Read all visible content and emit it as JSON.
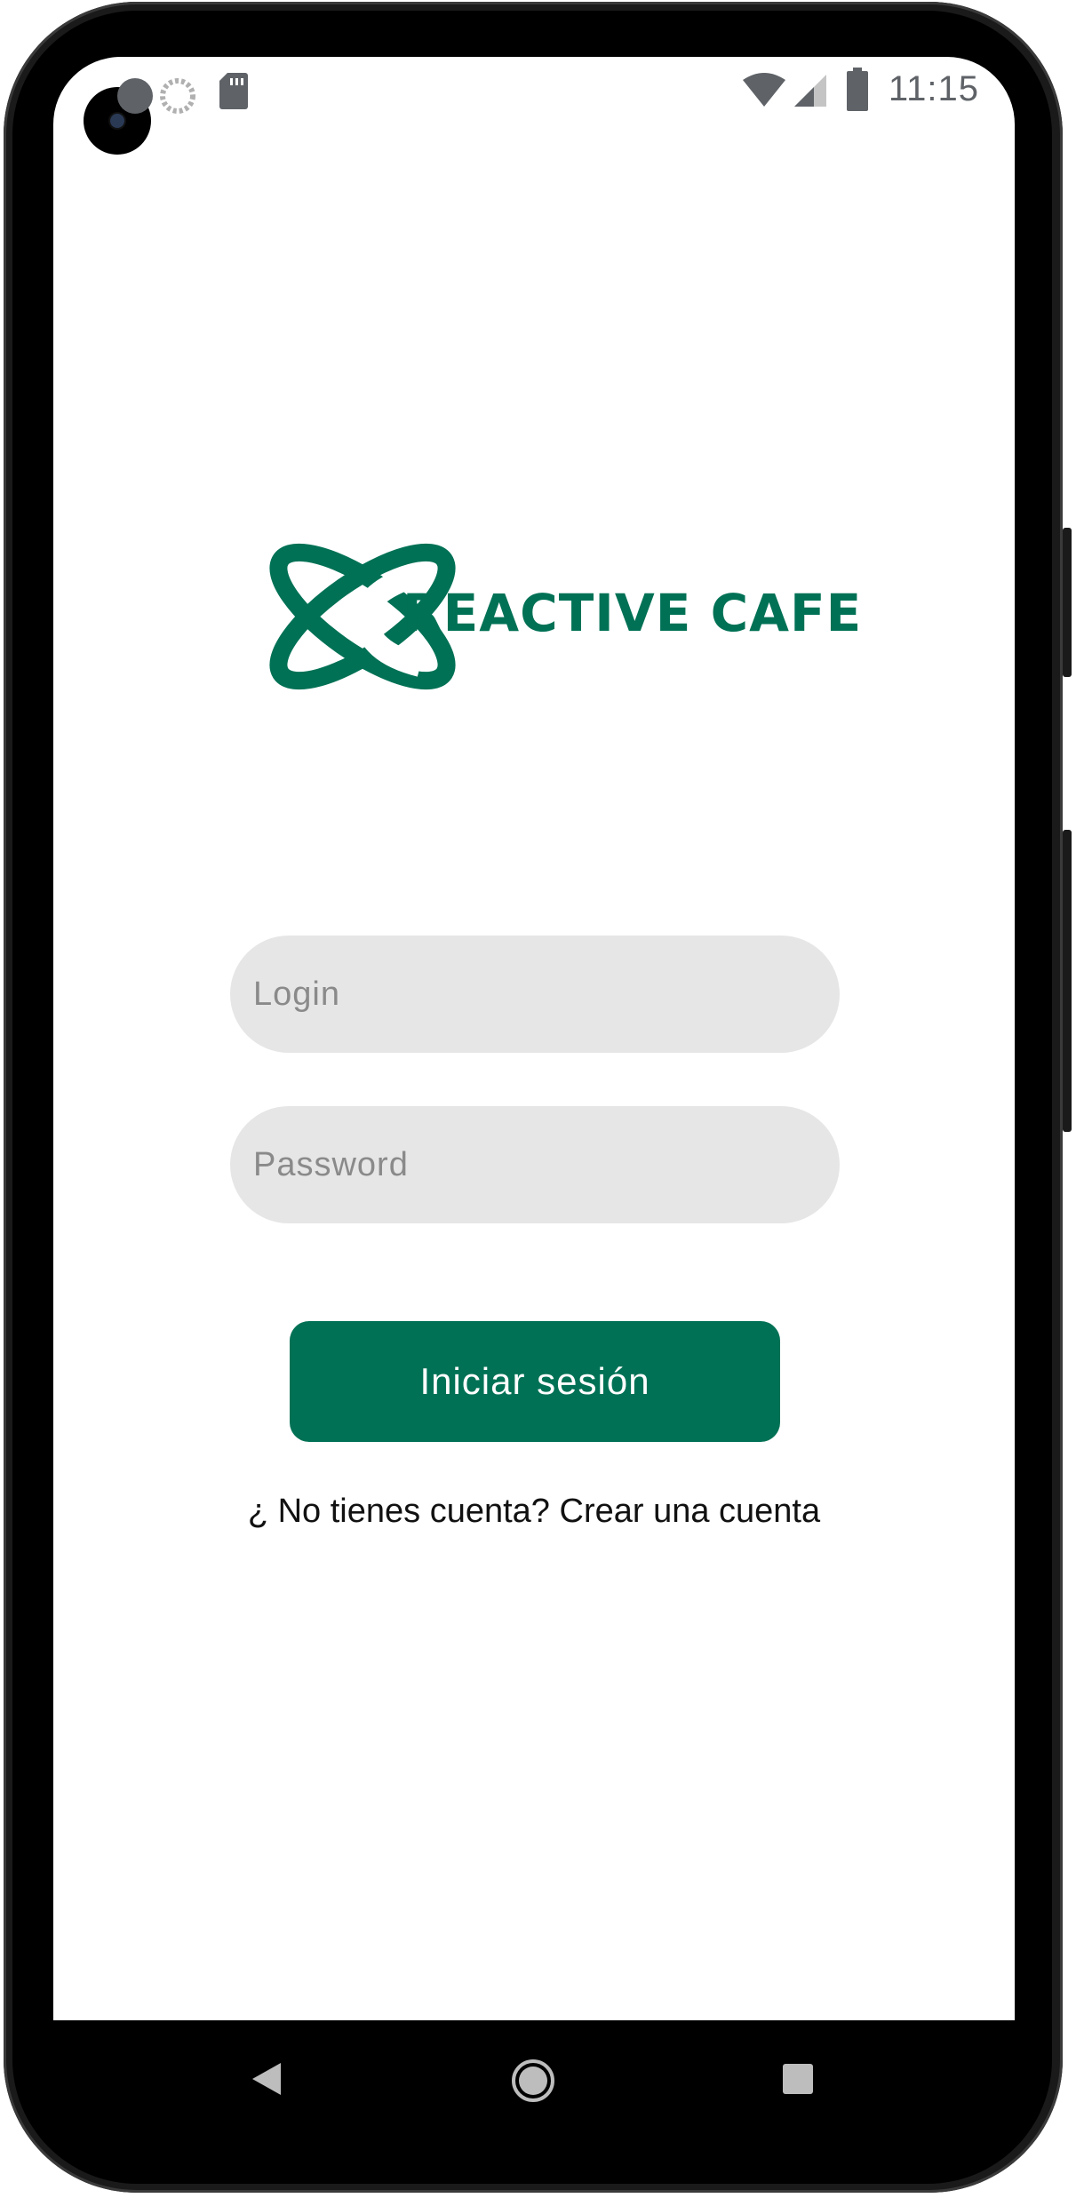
{
  "status_bar": {
    "time": "11:15",
    "left_icons": [
      "a-icon",
      "loading-circle-icon",
      "sd-card-icon"
    ],
    "right_icons": [
      "wifi-icon",
      "signal-icon",
      "battery-icon"
    ]
  },
  "logo": {
    "text": "REACTIVE CAFE",
    "color": "#007155"
  },
  "form": {
    "login_placeholder": "Login",
    "login_value": "",
    "password_placeholder": "Password",
    "password_value": "",
    "submit_label": "Iniciar sesión"
  },
  "register": {
    "question": "¿ No tienes cuenta?",
    "link": "Crear una cuenta"
  },
  "nav": {
    "icons": [
      "back-icon",
      "home-icon",
      "recents-icon"
    ]
  },
  "colors": {
    "accent": "#007155",
    "field_bg": "#e6e6e6"
  }
}
